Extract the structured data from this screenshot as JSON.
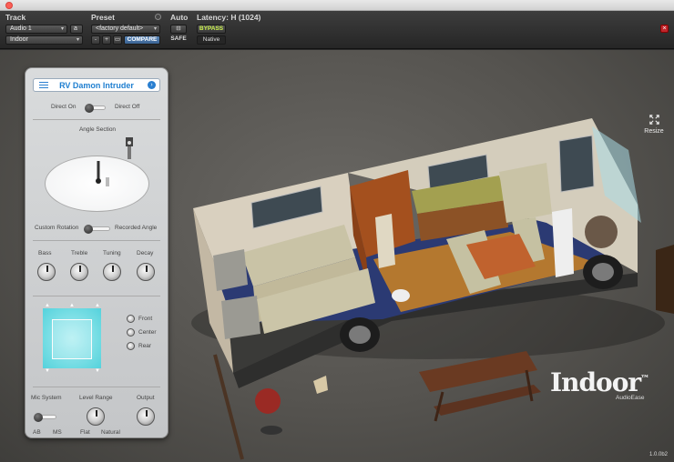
{
  "header": {
    "track_label": "Track",
    "preset_label": "Preset",
    "auto_label": "Auto",
    "latency_label": "Latency: H (1024)",
    "track_select": "Audio 1",
    "track_channel": "a",
    "insert_select": "Indoor",
    "preset_select": "<factory default>",
    "preset_minus": "-",
    "preset_plus": "+",
    "compare_label": "COMPARE",
    "bypass_label": "BYPASS",
    "safe_label": "SAFE",
    "native_label": "Native",
    "close_glyph": "×"
  },
  "panel": {
    "preset_name": "RV Damon Intruder",
    "direct_on": "Direct On",
    "direct_off": "Direct Off",
    "angle_section": "Angle Section",
    "custom_rotation": "Custom Rotation",
    "recorded_angle": "Recorded Angle",
    "knobs": [
      {
        "label": "Bass"
      },
      {
        "label": "Treble"
      },
      {
        "label": "Tuning"
      },
      {
        "label": "Decay"
      }
    ],
    "positions": [
      {
        "label": "Front",
        "selected": false
      },
      {
        "label": "Center",
        "selected": false
      },
      {
        "label": "Rear",
        "selected": false
      }
    ],
    "mic_system": "Mic System",
    "mic_ab": "AB",
    "mic_ms": "MS",
    "level_range": "Level Range",
    "level_flat": "Flat",
    "level_natural": "Natural",
    "output": "Output"
  },
  "scene": {
    "resize_label": "Resize",
    "brand_name": "Indoor",
    "brand_tm": "™",
    "brand_maker": "AudioEase",
    "version": "1.0.0b2"
  },
  "colors": {
    "accent_blue": "#1f7fd0",
    "bypass_green": "#c9f04a",
    "pad_cyan": "#4fd3dd",
    "close_red": "#c0272d"
  }
}
